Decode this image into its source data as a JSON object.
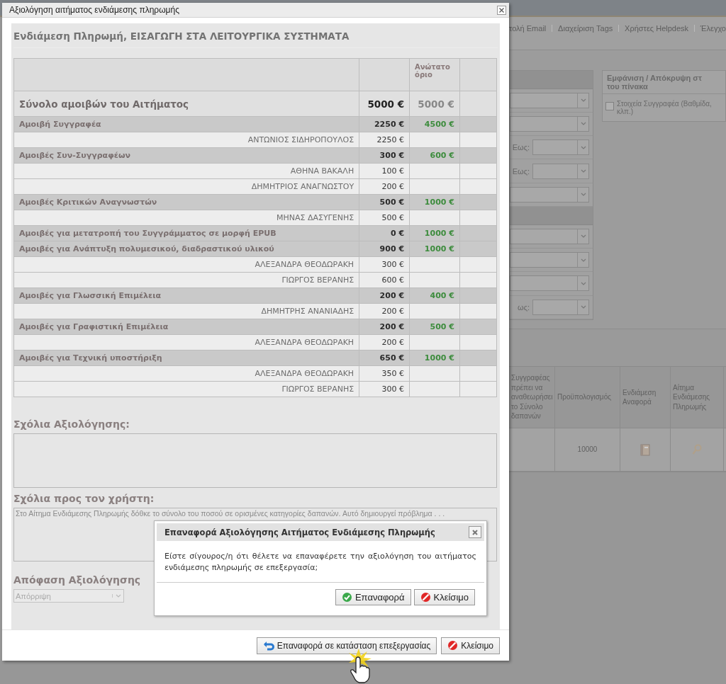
{
  "background": {
    "nav_links": [
      "τολή Email",
      "Διαχείριση Tags",
      "Χρήστες Helpdesk",
      "Έλεγχο"
    ],
    "filters": [
      {
        "kind": "header"
      },
      {
        "kind": "select"
      },
      {
        "kind": "select"
      },
      {
        "kind": "range",
        "label": "Εως:"
      },
      {
        "kind": "range",
        "label": "Εως:"
      },
      {
        "kind": "select"
      },
      {
        "kind": "header"
      },
      {
        "kind": "select"
      },
      {
        "kind": "select"
      },
      {
        "kind": "select"
      },
      {
        "kind": "range",
        "label": "ως:"
      }
    ],
    "visibility_panel": {
      "title_lines": [
        "Εμφάνιση / Απόκρυψη στ",
        "του πίνακα"
      ],
      "option_lines": [
        "Στοιχεία Συγγραφέα (Βαθμίδα,",
        "κλπ.)"
      ],
      "checked": false
    },
    "table": {
      "columns": [
        "Συγγραφέας πρέπει να αναθεωρήσει το Σύνολο δαπανών",
        "Προϋπολογισμός",
        "Ενδιάμεση Αναφορά",
        "Αίτημα Ενδιάμεσης Πληρωμής"
      ],
      "budget": "10000"
    }
  },
  "dialog": {
    "title": "Αξιολόγηση αιτήματος ενδιάμεσης πληρωμής",
    "heading": "Ενδιάμεση Πληρωμή, ΕΙΣΑΓΩΓΗ ΣΤΑ ΛΕΙΤΟΥΡΓΙΚΑ ΣΥΣΤΗΜΑΤΑ",
    "limit_header": "Ανώτατο όριο",
    "rows": [
      {
        "kind": "total",
        "label": "Σύνολο αμοιβών του Αιτήματος",
        "amount": "5000 €",
        "limit": "5000 €"
      },
      {
        "kind": "category",
        "label": "Αμοιβή Συγγραφέα",
        "amount": "2250 €",
        "limit": "4500 €"
      },
      {
        "kind": "person",
        "label": "ΑΝΤΩΝΙΟΣ ΣΙΔΗΡΟΠΟΥΛΟΣ",
        "amount": "2250 €"
      },
      {
        "kind": "category",
        "label": "Αμοιβές Συν-Συγγραφέων",
        "amount": "300 €",
        "limit": "600 €"
      },
      {
        "kind": "person",
        "label": "ΑΘΗΝΑ ΒΑΚΑΛΗ",
        "amount": "100 €"
      },
      {
        "kind": "person",
        "label": "ΔΗΜΗΤΡΙΟΣ ΑΝΑΓΝΩΣΤΟΥ",
        "amount": "200 €"
      },
      {
        "kind": "category",
        "label": "Αμοιβές Κριτικών Αναγνωστών",
        "amount": "500 €",
        "limit": "1000 €"
      },
      {
        "kind": "person",
        "label": "ΜΗΝΑΣ ΔΑΣΥΓΕΝΗΣ",
        "amount": "500 €"
      },
      {
        "kind": "category",
        "label": "Αμοιβές για μετατροπή του Συγγράμματος σε μορφή EPUB",
        "amount": "0 €",
        "limit": "1000 €"
      },
      {
        "kind": "category",
        "label": "Αμοιβές για Ανάπτυξη πολυμεσικού, διαδραστικού υλικού",
        "amount": "900 €",
        "limit": "1000 €"
      },
      {
        "kind": "person",
        "label": "ΑΛΕΞΑΝΔΡΑ ΘΕΟΔΩΡΑΚΗ",
        "amount": "300 €"
      },
      {
        "kind": "person",
        "label": "ΓΙΩΡΓΟΣ ΒΕΡΑΝΗΣ",
        "amount": "600 €"
      },
      {
        "kind": "category",
        "label": "Αμοιβές για Γλωσσική Επιμέλεια",
        "amount": "200 €",
        "limit": "400 €"
      },
      {
        "kind": "person",
        "label": "ΔΗΜΗΤΡΗΣ ΑΝΑΝΙΑΔΗΣ",
        "amount": "200 €"
      },
      {
        "kind": "category",
        "label": "Αμοιβές για Γραφιστική Επιμέλεια",
        "amount": "200 €",
        "limit": "500 €"
      },
      {
        "kind": "person",
        "label": "ΑΛΕΞΑΝΔΡΑ ΘΕΟΔΩΡΑΚΗ",
        "amount": "200 €"
      },
      {
        "kind": "category",
        "label": "Αμοιβές για Τεχνική υποστήριξη",
        "amount": "650 €",
        "limit": "1000 €"
      },
      {
        "kind": "person",
        "label": "ΑΛΕΞΑΝΔΡΑ ΘΕΟΔΩΡΑΚΗ",
        "amount": "350 €"
      },
      {
        "kind": "person",
        "label": "ΓΙΩΡΓΟΣ ΒΕΡΑΝΗΣ",
        "amount": "300 €"
      }
    ],
    "evaluation_comments_label": "Σχόλια Αξιολόγησης:",
    "user_comments_label": "Σχόλια προς τον χρήστη:",
    "user_comments": "Στο Αίτημα Ενδιάμεσης Πληρωμής δόθκε το σύνολο του ποσού σε ορισμένες κατηγορίες δαπανών. Αυτό δημιουργεί πρόβλημα . . .",
    "decision_label": "Απόφαση Αξιολόγησης",
    "decision": "Απόρριψη",
    "buttons": [
      {
        "kind": "revert",
        "label": "Επαναφορά σε κατάσταση επεξεργασίας"
      },
      {
        "kind": "close",
        "label": "Κλείσιμο"
      }
    ]
  },
  "confirm": {
    "title": "Επαναφορά Αξιολόγησης Αιτήματος Ενδιάμεσης Πληρωμής",
    "message": "Είστε σίγουρος/η ότι θέλετε να επαναφέρετε την αξιολόγηση του αιτήματος ενδιάμεσης πληρωμής σε επεξεργασία;",
    "buttons": [
      {
        "kind": "ok",
        "label": "Επαναφορά"
      },
      {
        "kind": "close",
        "label": "Κλείσιμο"
      }
    ]
  }
}
